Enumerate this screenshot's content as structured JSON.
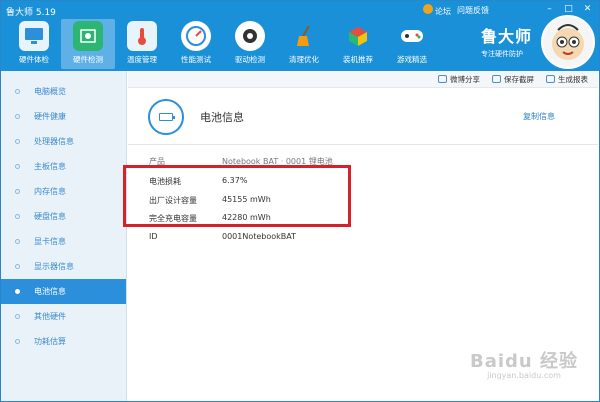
{
  "window": {
    "title": "鲁大师 5.19"
  },
  "top_links": {
    "forum": "论坛",
    "feedback": "问题反馈"
  },
  "window_controls": {
    "min": "–",
    "max": "□",
    "close": "✕"
  },
  "toolbar": [
    {
      "label": "硬件体检",
      "icon": "monitor-icon",
      "active": false
    },
    {
      "label": "硬件检测",
      "icon": "chip-icon",
      "active": true
    },
    {
      "label": "温度管理",
      "icon": "thermometer-icon",
      "active": false
    },
    {
      "label": "性能测试",
      "icon": "speedometer-icon",
      "active": false
    },
    {
      "label": "驱动检测",
      "icon": "gear-icon",
      "active": false
    },
    {
      "label": "清理优化",
      "icon": "broom-icon",
      "active": false
    },
    {
      "label": "装机推荐",
      "icon": "cube-icon",
      "active": false
    },
    {
      "label": "游戏精选",
      "icon": "gamepad-icon",
      "active": false
    }
  ],
  "brand": {
    "name": "鲁大师",
    "slogan": "专注硬件防护"
  },
  "sidebar": {
    "items": [
      {
        "label": "电脑概览"
      },
      {
        "label": "硬件健康"
      },
      {
        "label": "处理器信息"
      },
      {
        "label": "主板信息"
      },
      {
        "label": "内存信息"
      },
      {
        "label": "硬盘信息"
      },
      {
        "label": "显卡信息"
      },
      {
        "label": "显示器信息"
      },
      {
        "label": "电池信息"
      },
      {
        "label": "其他硬件"
      },
      {
        "label": "功耗估算"
      }
    ]
  },
  "actionbar": {
    "share": "微博分享",
    "screenshot": "保存截屏",
    "report": "生成报表"
  },
  "main": {
    "section_title": "电池信息",
    "copy_link": "复制信息",
    "rows": [
      {
        "key": "产品",
        "value": "Notebook BAT · 0001 锂电池"
      },
      {
        "key": "电池损耗",
        "value": "6.37%"
      },
      {
        "key": "出厂设计容量",
        "value": "45155 mWh"
      },
      {
        "key": "完全充电容量",
        "value": "42280 mWh"
      },
      {
        "key": "ID",
        "value": "0001NotebookBAT"
      }
    ]
  },
  "watermark": {
    "line1": "Baidu 经验",
    "line2": "jingyan.baidu.com"
  },
  "colors": {
    "header": "#1a90d9",
    "sidebar_active": "#2b8fdb",
    "highlight": "#d6202a"
  }
}
